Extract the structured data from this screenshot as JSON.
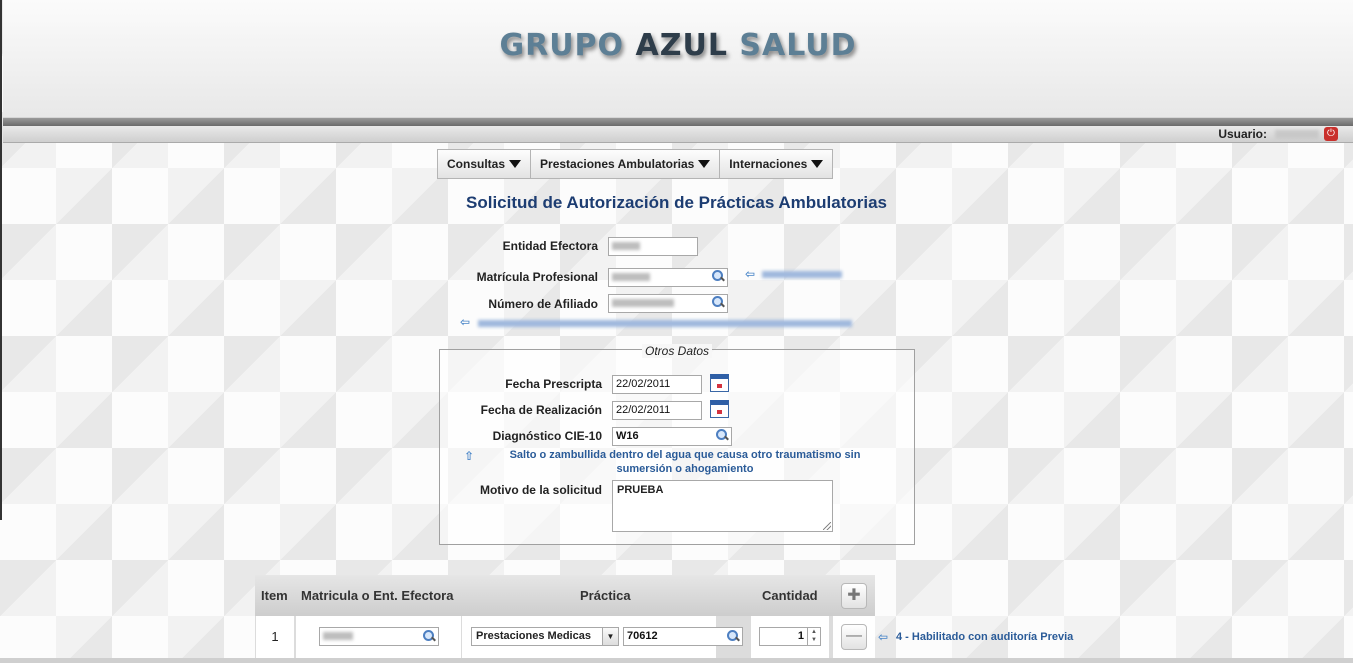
{
  "header": {
    "brand_part1": "GRUPO ",
    "brand_part2": "AZUL",
    "brand_part3": " SALUD",
    "user_label": "Usuario:"
  },
  "menu": {
    "items": [
      {
        "label": "Consultas"
      },
      {
        "label": "Prestaciones Ambulatorias"
      },
      {
        "label": "Internaciones"
      }
    ]
  },
  "page_title": "Solicitud de Autorización de Prácticas Ambulatorias",
  "form": {
    "entidad_label": "Entidad Efectora",
    "matricula_label": "Matrícula Profesional",
    "afiliado_label": "Número de Afiliado"
  },
  "otros_datos": {
    "legend": "Otros Datos",
    "fecha_prescripta_label": "Fecha Prescripta",
    "fecha_prescripta_value": "22/02/2011",
    "fecha_realizacion_label": "Fecha de Realización",
    "fecha_realizacion_value": "22/02/2011",
    "diagnostico_label": "Diagnóstico CIE-10",
    "diagnostico_value": "W16",
    "diagnostico_desc": "Salto o zambullida dentro del agua que causa otro traumatismo sin sumersión o ahogamiento",
    "motivo_label": "Motivo de la solicitud",
    "motivo_value": "PRUEBA"
  },
  "grid": {
    "headers": {
      "item": "Item",
      "matricula": "Matricula o Ent. Efectora",
      "practica": "Práctica",
      "cantidad": "Cantidad"
    },
    "rows": [
      {
        "item": "1",
        "practica_tipo": "Prestaciones Medicas",
        "practica_codigo": "70612",
        "cantidad": "1",
        "estado": "4 - Habilitado con auditoría Previa"
      }
    ]
  },
  "colors": {
    "title": "#1d3d72",
    "link": "#2a5b98",
    "brand": "#5d7f95"
  }
}
